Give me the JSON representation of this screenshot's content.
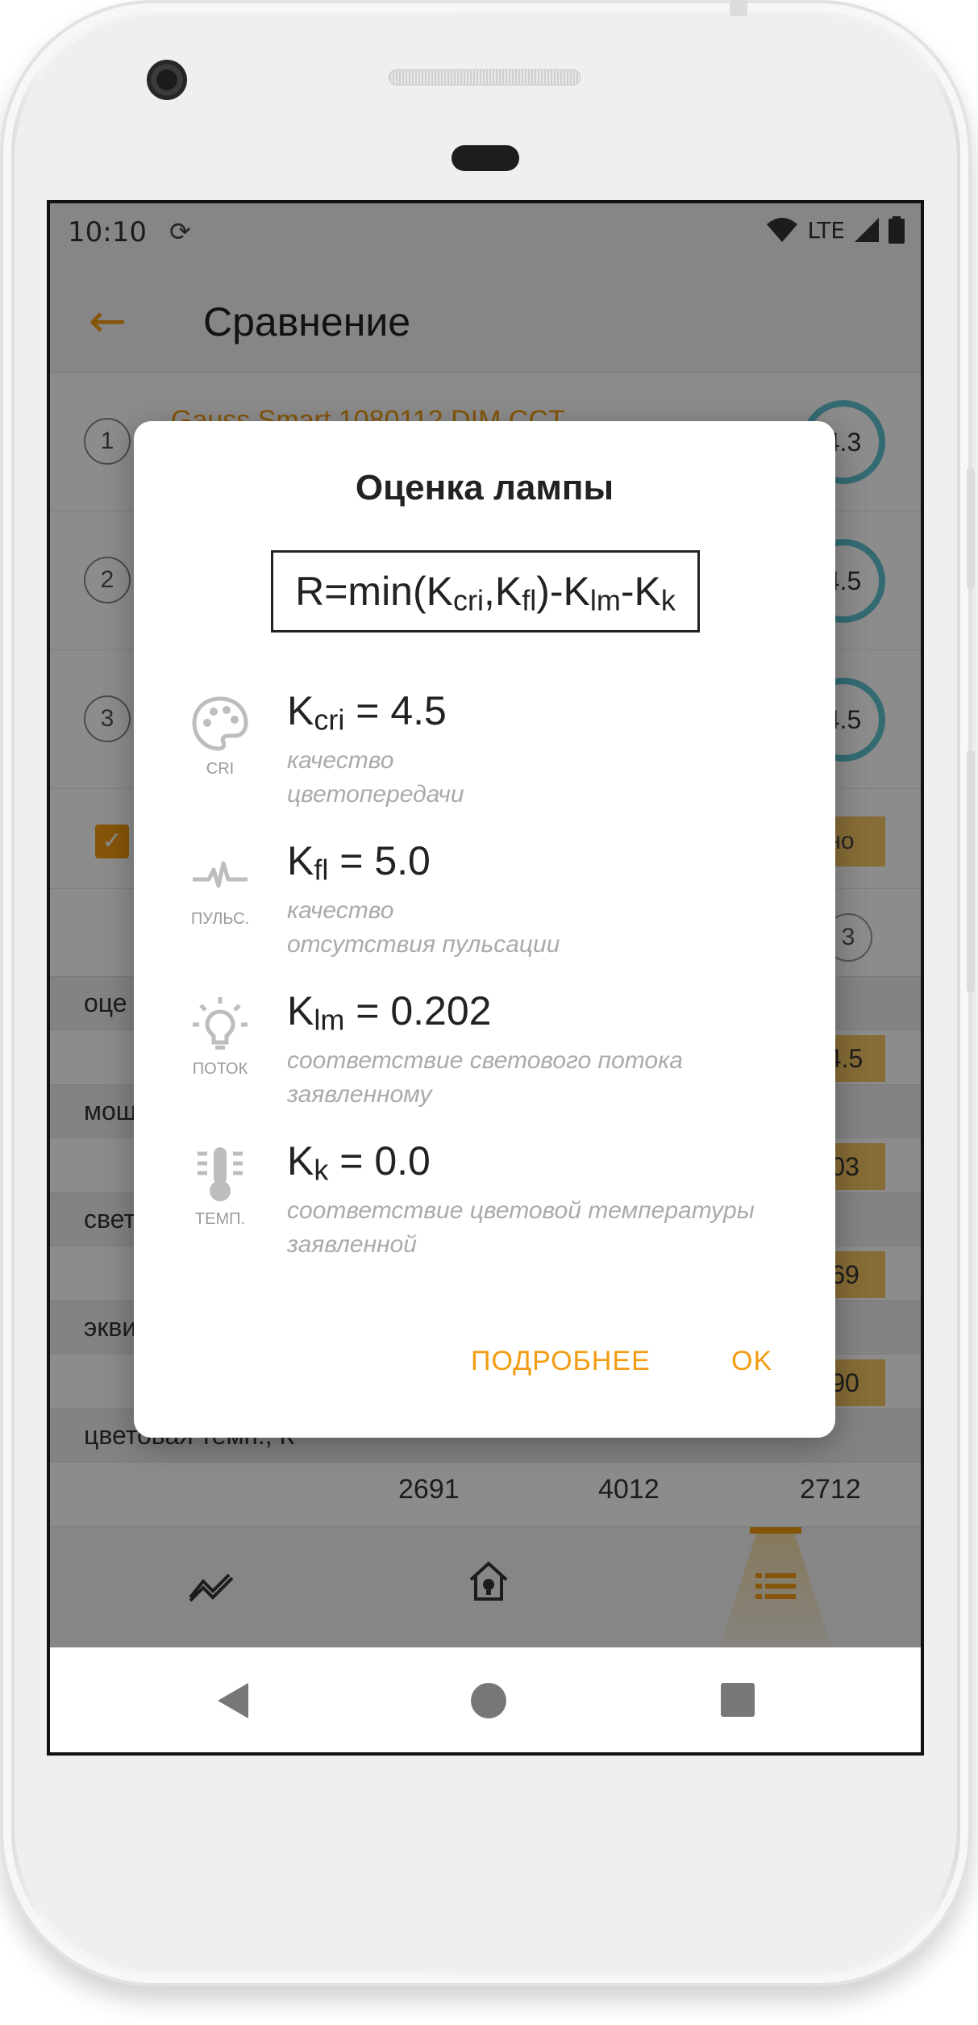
{
  "status": {
    "time": "10:10",
    "network": "LTE"
  },
  "appbar": {
    "title": "Сравнение"
  },
  "lamps": [
    {
      "num": "1",
      "name": "Gauss Smart 1080112 DIM CCT",
      "score": "4.3"
    },
    {
      "num": "2",
      "name": "",
      "score": "4.5"
    },
    {
      "num": "3",
      "name": "",
      "score": "4.5"
    }
  ],
  "compare": {
    "only_label": "но",
    "filter_count": "3",
    "rows": [
      {
        "label": "оце",
        "best": "4.5"
      },
      {
        "label": "мощ",
        "best": "03"
      },
      {
        "label": "свет",
        "best": "69"
      },
      {
        "label": "экви",
        "best": "90"
      }
    ],
    "temp_label": "цветовая темп., К",
    "temp_values": [
      "2691",
      "4012",
      "2712"
    ]
  },
  "dialog": {
    "title": "Оценка лампы",
    "formula": {
      "prefix": "R=min(K",
      "cri": "cri",
      "comma_k": ",K",
      "fl": "fl",
      "mid": ")-K",
      "lm": "lm",
      "dash_k": "-K",
      "k": "k"
    },
    "items": [
      {
        "icon": "palette-icon",
        "icon_label": "CRI",
        "k": "K",
        "sub": "cri",
        "value": " = 4.5",
        "desc1": "качество",
        "desc2": "цветопередачи"
      },
      {
        "icon": "pulse-icon",
        "icon_label": "ПУЛЬС.",
        "k": "K",
        "sub": "fl",
        "value": " = 5.0",
        "desc1": "качество",
        "desc2": "отсутствия пульсации"
      },
      {
        "icon": "bulb-icon",
        "icon_label": "ПОТОК",
        "k": "K",
        "sub": "lm",
        "value": " = 0.202",
        "desc1": "соответствие светового потока",
        "desc2": "заявленному"
      },
      {
        "icon": "thermometer-icon",
        "icon_label": "ТЕМП.",
        "k": "K",
        "sub": "k",
        "value": " = 0.0",
        "desc1": "соответствие цветовой температуры",
        "desc2": "заявленной"
      }
    ],
    "more_button": "ПОДРОБНЕЕ",
    "ok_button": "OK"
  },
  "colors": {
    "accent": "#f39c12",
    "score_ring": "#5fc3d2",
    "highlight": "#f5c563"
  }
}
